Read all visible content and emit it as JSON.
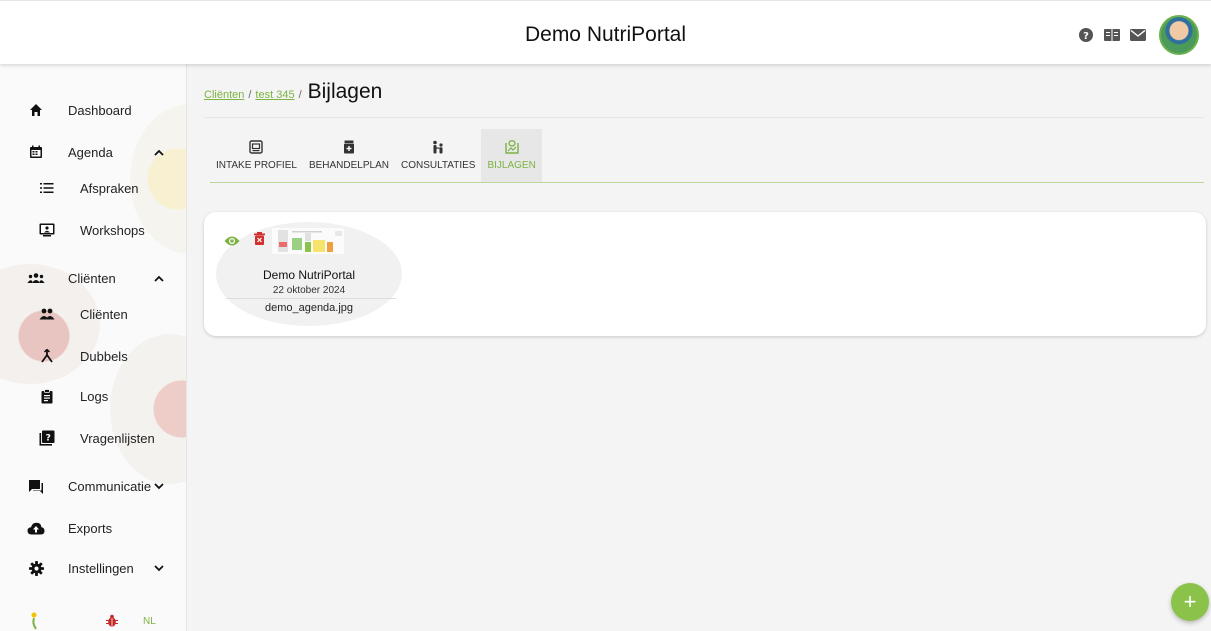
{
  "app": {
    "title": "Demo NutriPortal"
  },
  "header_icons": [
    "help-icon",
    "book-icon",
    "mail-icon"
  ],
  "sidebar": {
    "items": [
      {
        "label": "Dashboard",
        "icon": "home-icon"
      },
      {
        "label": "Agenda",
        "icon": "calendar-icon",
        "expanded": true
      },
      {
        "label": "Afspraken",
        "icon": "list-icon"
      },
      {
        "label": "Workshops",
        "icon": "presentation-icon"
      },
      {
        "label": "Cliënten",
        "icon": "group-icon",
        "expanded": true
      },
      {
        "label": "Cliënten",
        "icon": "people-icon"
      },
      {
        "label": "Dubbels",
        "icon": "merge-icon"
      },
      {
        "label": "Logs",
        "icon": "clipboard-icon"
      },
      {
        "label": "Vragenlijsten",
        "icon": "quiz-icon"
      },
      {
        "label": "Communicatie",
        "icon": "chat-icon",
        "expanded": false
      },
      {
        "label": "Exports",
        "icon": "cloud-upload-icon"
      },
      {
        "label": "Instellingen",
        "icon": "gear-icon",
        "expanded": false
      }
    ],
    "footer": {
      "language": "NL"
    }
  },
  "breadcrumb": {
    "items": [
      "Cliënten",
      "test 345"
    ],
    "separator": "/",
    "current": "Bijlagen"
  },
  "tabs": [
    {
      "label": "INTAKE PROFIEL",
      "icon": "profile-icon"
    },
    {
      "label": "BEHANDELPLAN",
      "icon": "pill-jar-icon"
    },
    {
      "label": "CONSULTATIES",
      "icon": "consult-icon"
    },
    {
      "label": "BIJLAGEN",
      "icon": "attachment-icon",
      "active": true
    }
  ],
  "attachments": [
    {
      "title": "Demo NutriPortal",
      "date": "22 oktober 2024",
      "filename": "demo_agenda.jpg"
    }
  ],
  "fab": {
    "label": "+"
  },
  "colors": {
    "accent": "#7cb342",
    "fab": "#8bc34a",
    "delete": "#d32f2f"
  }
}
